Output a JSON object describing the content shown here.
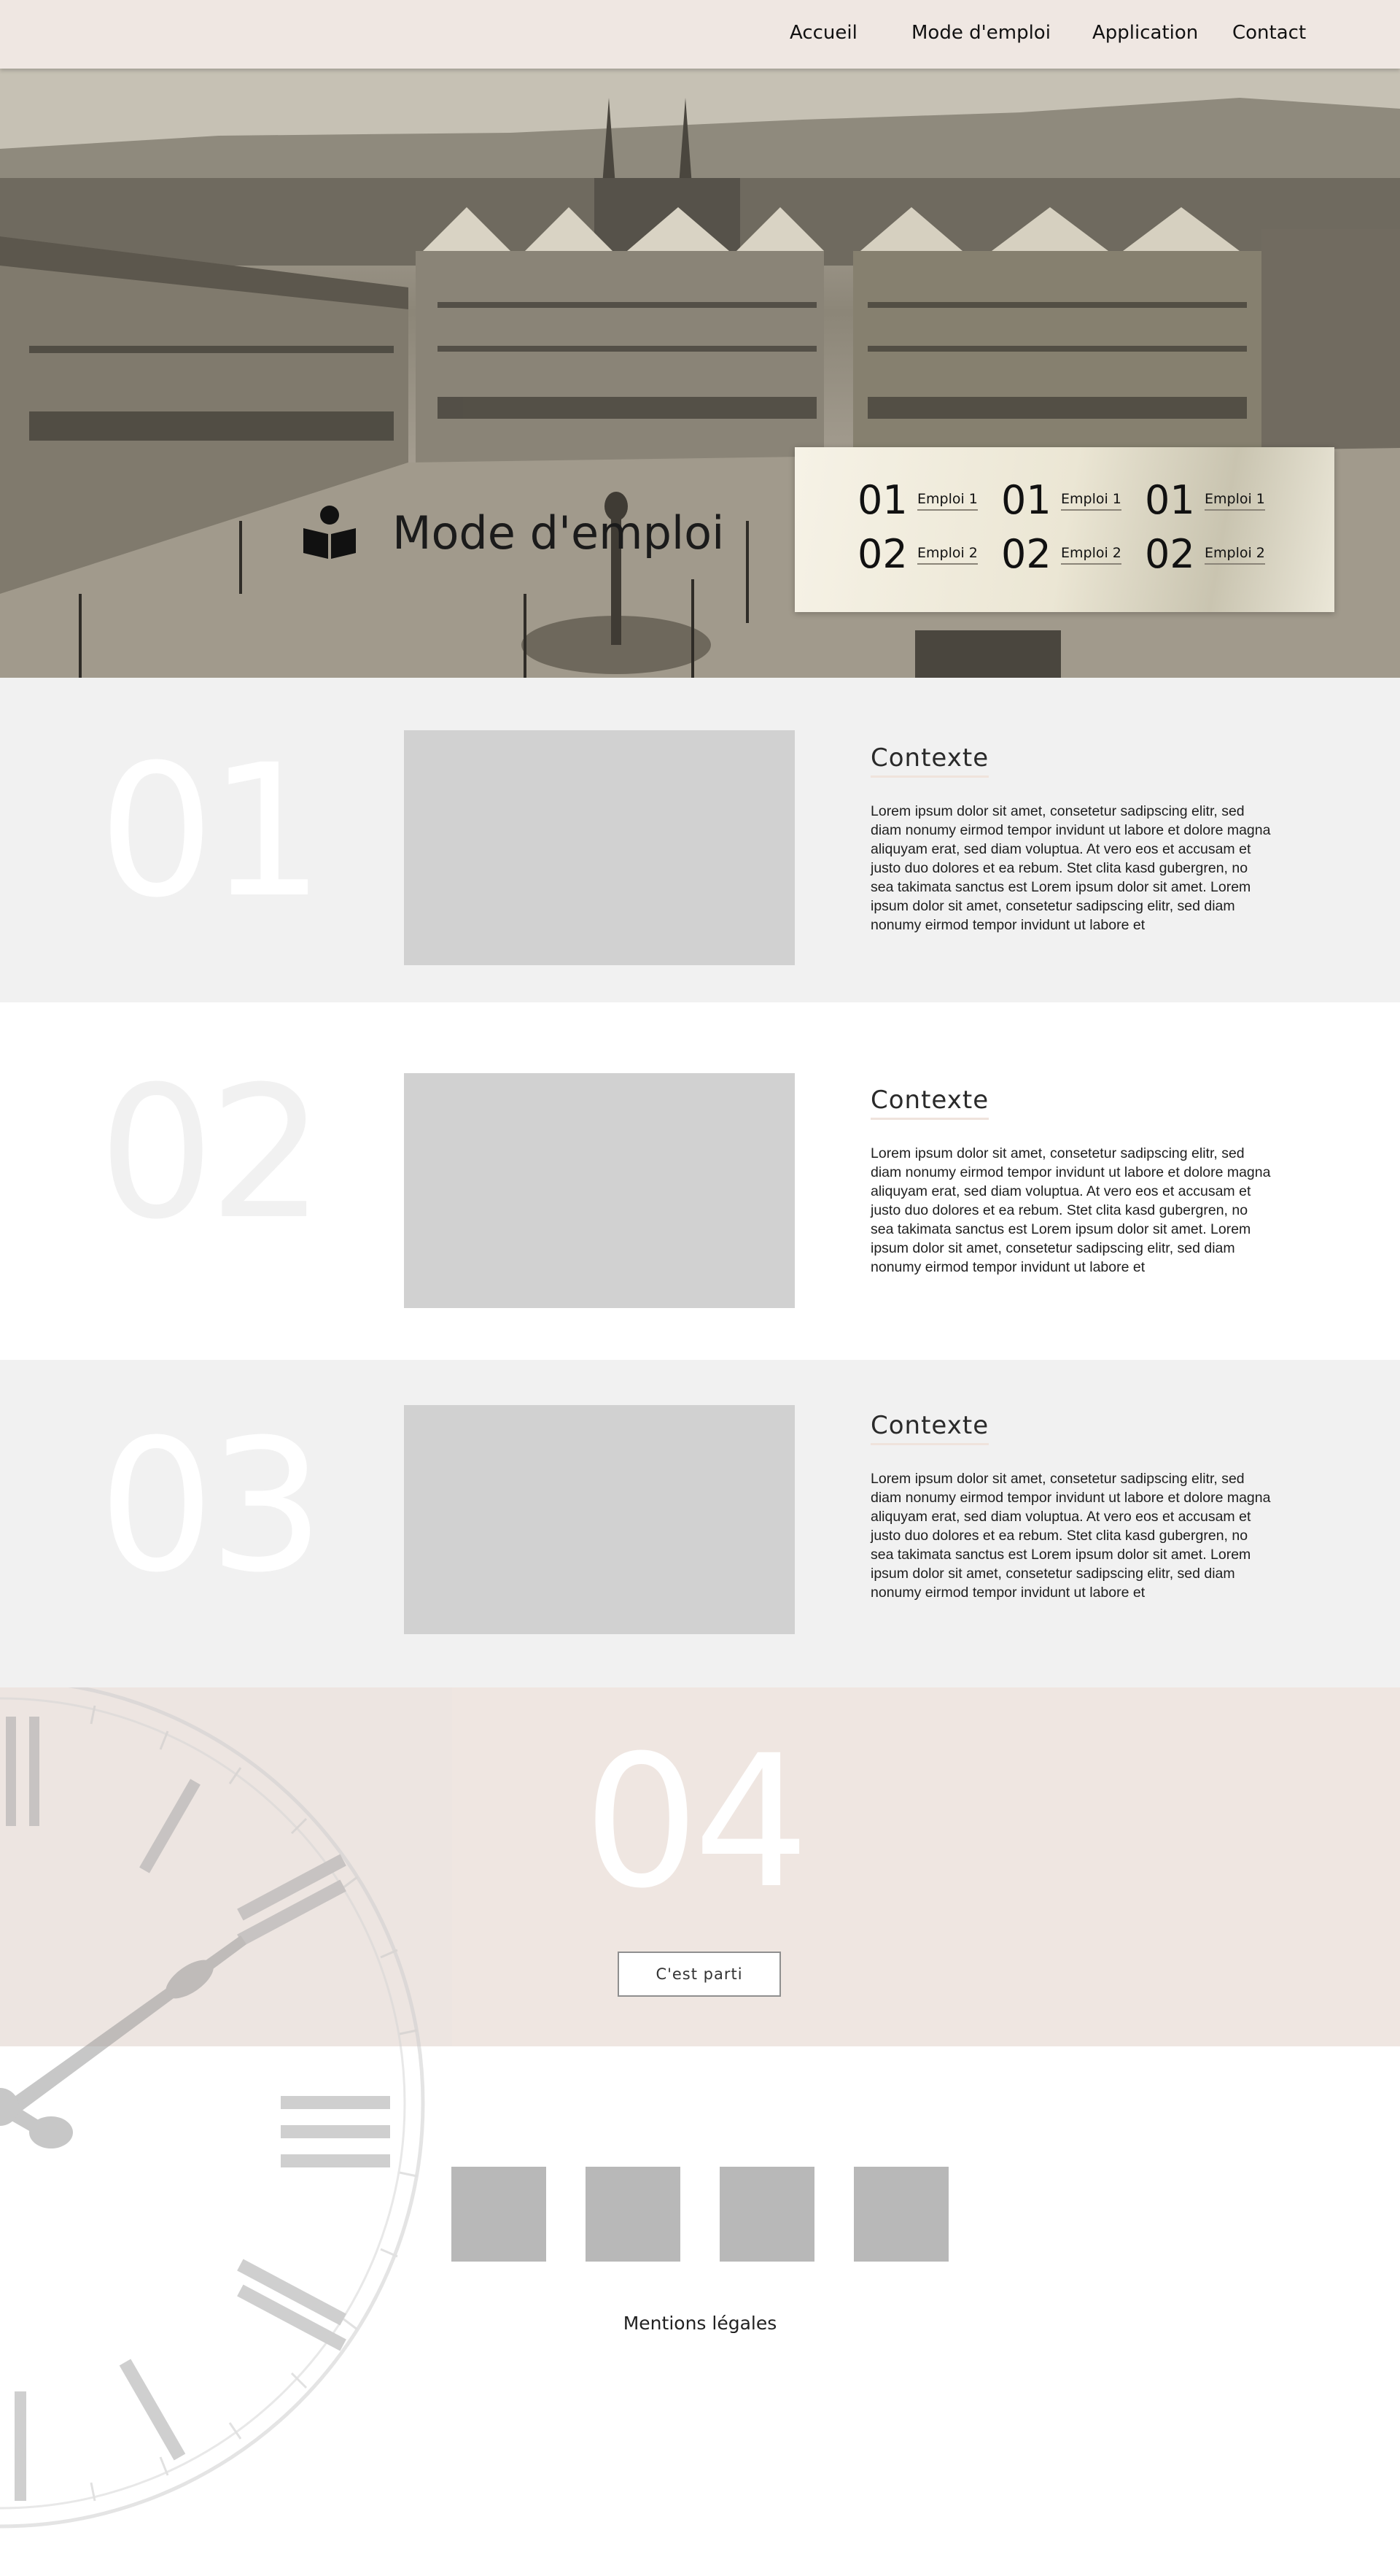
{
  "nav": {
    "items": [
      {
        "label": "Accueil"
      },
      {
        "label": "Mode d'emploi"
      },
      {
        "label": "Application"
      },
      {
        "label": "Contact"
      }
    ]
  },
  "hero": {
    "title": "Mode d'emploi",
    "icon": "book-reader-icon",
    "panel": {
      "columns": [
        [
          {
            "num": "01",
            "label": "Emploi 1"
          },
          {
            "num": "02",
            "label": "Emploi 2"
          }
        ],
        [
          {
            "num": "01",
            "label": "Emploi 1"
          },
          {
            "num": "02",
            "label": "Emploi 2"
          }
        ],
        [
          {
            "num": "01",
            "label": "Emploi 1"
          },
          {
            "num": "02",
            "label": "Emploi 2"
          }
        ]
      ]
    }
  },
  "sections": [
    {
      "number": "01",
      "title": "Contexte",
      "body": "Lorem ipsum dolor sit amet, consetetur sadipscing elitr, sed diam nonumy eirmod tempor invidunt ut labore et dolore magna aliquyam erat, sed diam voluptua. At vero eos et accusam et justo duo dolores et ea rebum. Stet clita kasd gubergren, no sea takimata sanctus est Lorem ipsum dolor sit amet. Lorem ipsum dolor sit amet, consetetur sadipscing elitr, sed diam nonumy eirmod tempor invidunt ut labore et"
    },
    {
      "number": "02",
      "title": "Contexte",
      "body": "Lorem ipsum dolor sit amet, consetetur sadipscing elitr, sed diam nonumy eirmod tempor invidunt ut labore et dolore magna aliquyam erat, sed diam voluptua. At vero eos et accusam et justo duo dolores et ea rebum. Stet clita kasd gubergren, no sea takimata sanctus est Lorem ipsum dolor sit amet. Lorem ipsum dolor sit amet, consetetur sadipscing elitr, sed diam nonumy eirmod tempor invidunt ut labore et"
    },
    {
      "number": "03",
      "title": "Contexte",
      "body": "Lorem ipsum dolor sit amet, consetetur sadipscing elitr, sed diam nonumy eirmod tempor invidunt ut labore et dolore magna aliquyam erat, sed diam voluptua. At vero eos et accusam et justo duo dolores et ea rebum. Stet clita kasd gubergren, no sea takimata sanctus est Lorem ipsum dolor sit amet. Lorem ipsum dolor sit amet, consetetur sadipscing elitr, sed diam nonumy eirmod tempor invidunt ut labore et"
    }
  ],
  "cta": {
    "number": "04",
    "button_label": "C'est parti",
    "decoration": "clock-face-icon"
  },
  "footer": {
    "social_icons": [
      "social-icon-1",
      "social-icon-2",
      "social-icon-3",
      "social-icon-4"
    ],
    "mentions": "Mentions légales"
  },
  "colors": {
    "nav_bg": "#efe7e2",
    "section_alt_bg": "#f1f1f1",
    "cta_bg": "#efe6e1",
    "image_placeholder": "#d1d1d1",
    "social_placeholder": "#b8b8b8",
    "big_number_on_grey": "#ffffff",
    "big_number_on_white": "#f1f1f1"
  }
}
